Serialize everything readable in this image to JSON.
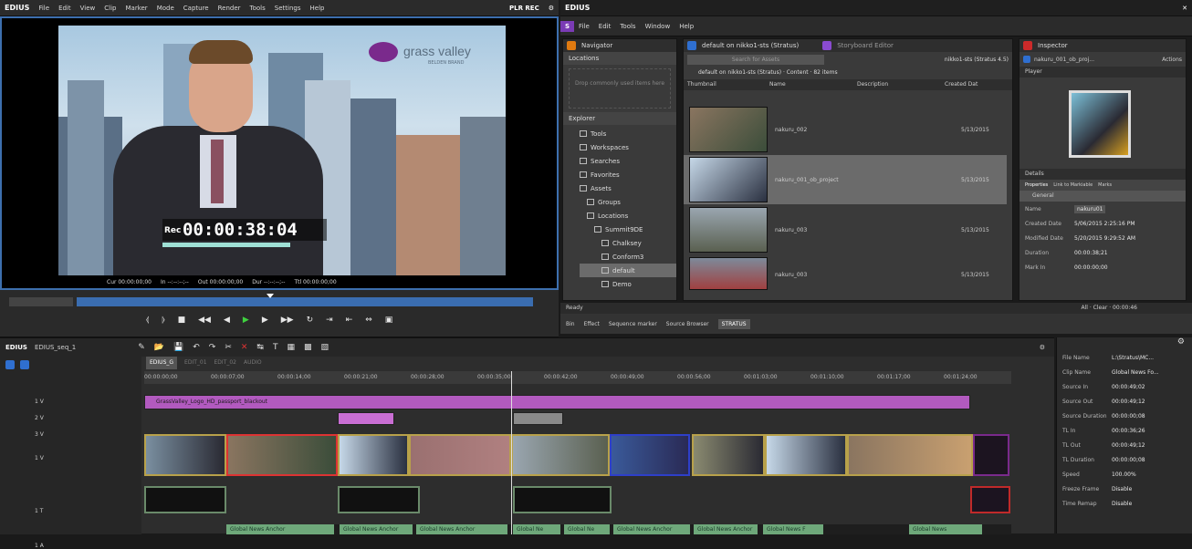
{
  "player": {
    "menu": [
      "EDIUS",
      "File",
      "Edit",
      "View",
      "Clip",
      "Marker",
      "Mode",
      "Capture",
      "Render",
      "Tools",
      "Settings",
      "Help"
    ],
    "status": "PLR REC",
    "timecode_label": "Rec",
    "timecode": "00:00:38:04",
    "info": [
      "Cur 00:00:00;00",
      "In --:--:--;--",
      "Out 00:00:00;00",
      "Dur --:--:--;--",
      "Ttl 00:00:00;00"
    ],
    "logo_text": "grass valley",
    "logo_sub": "BELDEN BRAND"
  },
  "strata": {
    "title": "EDIUS",
    "menu": [
      "File",
      "Edit",
      "Tools",
      "Window",
      "Help"
    ],
    "navigator": {
      "title": "Navigator",
      "locations_label": "Locations",
      "locations_hint": "Drop commonly used items here",
      "explorer_label": "Explorer",
      "items": [
        "Tools",
        "Workspaces",
        "Searches",
        "Favorites",
        "Assets",
        "Groups",
        "Locations",
        "Summit9DE",
        "Chalksey",
        "Conform3",
        "default",
        "Demo"
      ]
    },
    "content": {
      "tab1": "default on nikko1-sts (Stratus)",
      "tab2": "Storyboard Editor",
      "search_placeholder": "Search for Assets",
      "location": "nikko1-sts (Stratus 4.5)",
      "breadcrumb": "default on nikko1-sts (Stratus) · Content · 82 items",
      "columns": [
        "Thumbnail",
        "Name",
        "Description",
        "Created Dat"
      ],
      "rows": [
        {
          "name": "nakuru_002",
          "date": "5/13/2015"
        },
        {
          "name": "nakuru_001_ob_project",
          "date": "5/13/2015"
        },
        {
          "name": "nakuru_003",
          "date": "5/13/2015"
        },
        {
          "name": "nakuru_003",
          "date": "5/13/2015"
        }
      ]
    },
    "inspector": {
      "title": "Inspector",
      "asset": "nakuru_001_ob_proj...",
      "actions": "Actions",
      "player_label": "Player",
      "details_label": "Details",
      "tabs": [
        "Properties",
        "Link to Markiable",
        "Marks"
      ],
      "group": "General",
      "fields": [
        {
          "k": "Name",
          "v": "nakuru01"
        },
        {
          "k": "Created Date",
          "v": "5/06/2015 2:25:16 PM"
        },
        {
          "k": "Modified Date",
          "v": "5/20/2015 9:29:52 AM"
        },
        {
          "k": "Duration",
          "v": "00:00:38;21"
        },
        {
          "k": "Mark In",
          "v": "00:00:00;00"
        }
      ]
    },
    "bottom_tabs": [
      "Bin",
      "Effect",
      "Sequence marker",
      "Source Browser",
      "STRATUS"
    ],
    "status_label": "Ready",
    "status_right": "All · Clear · 00:00:46"
  },
  "timeline": {
    "project": "EDIUS_seq_1",
    "seq_tabs": [
      "EDIUS_G",
      "EDIT_01",
      "EDIT_02",
      "AUDIO"
    ],
    "ruler": [
      "00:00:00;00",
      "00:00:07;00",
      "00:00:14;00",
      "00:00:21;00",
      "00:00:28;00",
      "00:00:35;00",
      "00:00:42;00",
      "00:00:49;00",
      "00:00:56;00",
      "00:01:03;00",
      "00:01:10;00",
      "00:01:17;00",
      "00:01:24;00"
    ],
    "tracks": [
      "1 V",
      "2 V",
      "3 V",
      "1 V",
      "1 T",
      "1 A"
    ],
    "title_clip": "GrassValley_Logo_HD_passport_blackout",
    "audio_clips": [
      "Global News Anchor",
      "Global News Anchor",
      "Global News Anchor",
      "Global Ne",
      "Global Ne",
      "Global News Anchor",
      "Global News Anchor",
      "Global News F",
      "Global News"
    ]
  },
  "clip_info": {
    "fields": [
      {
        "k": "File Name",
        "v": "L:\\Stratus\\MC..."
      },
      {
        "k": "Clip Name",
        "v": "Global News Fo..."
      },
      {
        "k": "Source In",
        "v": "00:00:49;02"
      },
      {
        "k": "Source Out",
        "v": "00:00:49;12"
      },
      {
        "k": "Source Duration",
        "v": "00:00:00;08"
      },
      {
        "k": "TL In",
        "v": "00:00:36;26"
      },
      {
        "k": "TL Out",
        "v": "00:00:49;12"
      },
      {
        "k": "TL Duration",
        "v": "00:00:00;08"
      },
      {
        "k": "Speed",
        "v": "100.00%"
      },
      {
        "k": "Freeze Frame",
        "v": "Disable"
      },
      {
        "k": "Time Remap",
        "v": "Disable"
      }
    ]
  },
  "colors": {
    "accent": "#2f6fd0",
    "selection": "#6b6b6b",
    "title_track": "#b25abf",
    "audio_clip": "#6ea87a",
    "clip_border": "#b8a14a"
  }
}
